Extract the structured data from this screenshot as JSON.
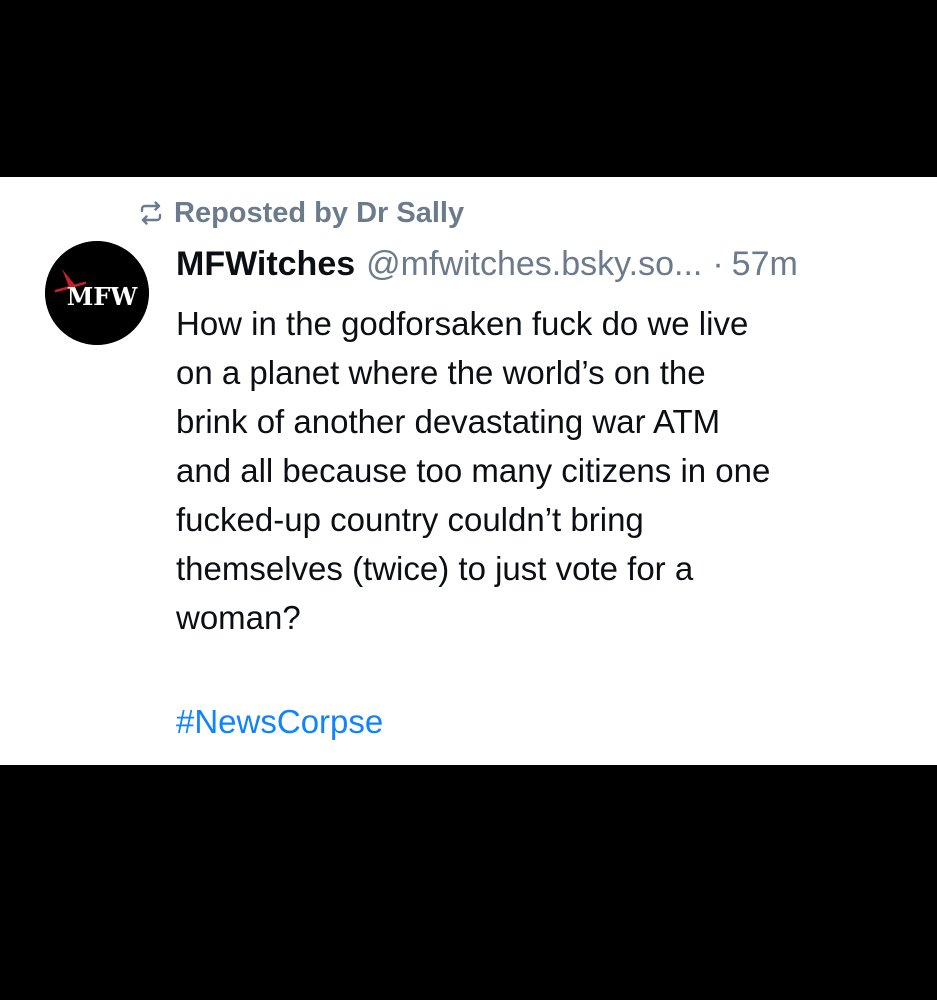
{
  "repost": {
    "icon": "repost-icon",
    "label": "Reposted by Dr Sally"
  },
  "post": {
    "avatar": {
      "icon": "mfw-logo",
      "logo_text": "MFW"
    },
    "display_name": "MFWitches",
    "handle": "@mfwitches.bsky.so...",
    "separator": "·",
    "time": "57m",
    "body_lines": [
      "How in the godforsaken fuck do we live",
      "on a planet where the world’s on the",
      "brink of another devastating war ATM",
      "and all because too many citizens in one",
      "fucked-up country couldn’t bring",
      "themselves (twice) to just vote for a",
      "woman?"
    ],
    "hashtag": "#NewsCorpse"
  },
  "colors": {
    "background": "#000000",
    "card": "#ffffff",
    "text": "#0b0f14",
    "muted": "#6b7b8c",
    "link": "#1083fe",
    "logo_accent": "#c8202a"
  }
}
